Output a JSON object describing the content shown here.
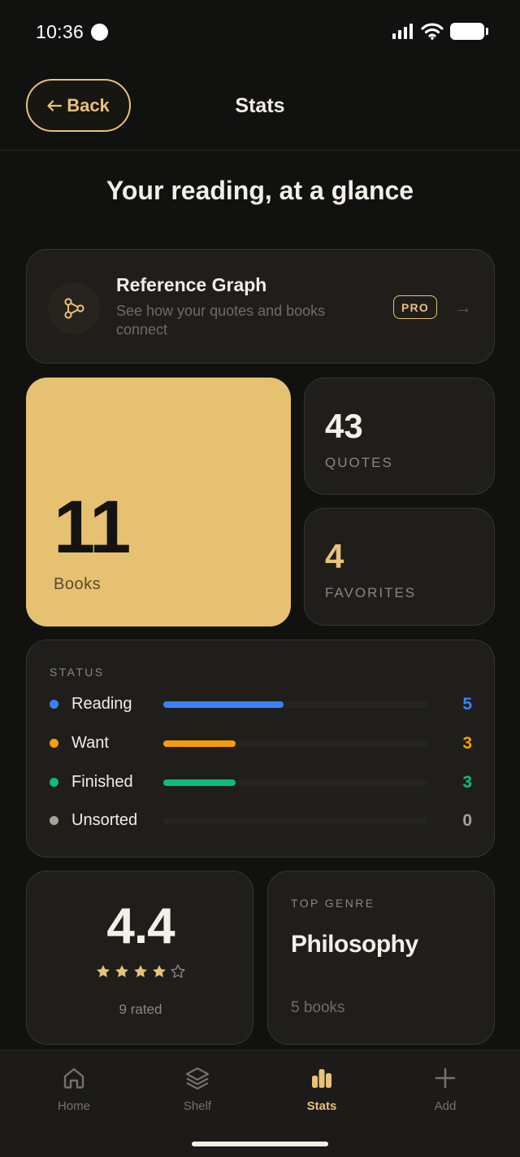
{
  "status_bar": {
    "time": "10:36"
  },
  "header": {
    "back_label": "Back",
    "title": "Stats"
  },
  "heading": "Your reading, at a glance",
  "reference_graph": {
    "title": "Reference Graph",
    "subtitle": "See how your quotes and books connect",
    "badge": "PRO"
  },
  "books": {
    "value": "11",
    "label": "Books"
  },
  "quotes": {
    "value": "43",
    "label": "QUOTES"
  },
  "favorites": {
    "value": "4",
    "label": "FAVORITES"
  },
  "status": {
    "heading": "STATUS",
    "max": 11,
    "items": [
      {
        "label": "Reading",
        "count": "5",
        "value": 5,
        "color": "#3b82f6"
      },
      {
        "label": "Want",
        "count": "3",
        "value": 3,
        "color": "#f59e0b"
      },
      {
        "label": "Finished",
        "count": "3",
        "value": 3,
        "color": "#10b981"
      },
      {
        "label": "Unsorted",
        "count": "0",
        "value": 0,
        "color": "#a8a296"
      }
    ]
  },
  "rating": {
    "value": "4.4",
    "stars_filled": 4,
    "stars_total": 5,
    "subtitle": "9 rated"
  },
  "top_genre": {
    "label": "TOP GENRE",
    "name": "Philosophy",
    "count": "5 books"
  },
  "tabs": [
    {
      "label": "Home",
      "icon": "home-icon",
      "active": false
    },
    {
      "label": "Shelf",
      "icon": "layers-icon",
      "active": false
    },
    {
      "label": "Stats",
      "icon": "bar-chart-icon",
      "active": true
    },
    {
      "label": "Add",
      "icon": "plus-icon",
      "active": false
    }
  ],
  "colors": {
    "accent": "#e7c27a",
    "books_card": "#e6c171",
    "background": "#111110"
  }
}
